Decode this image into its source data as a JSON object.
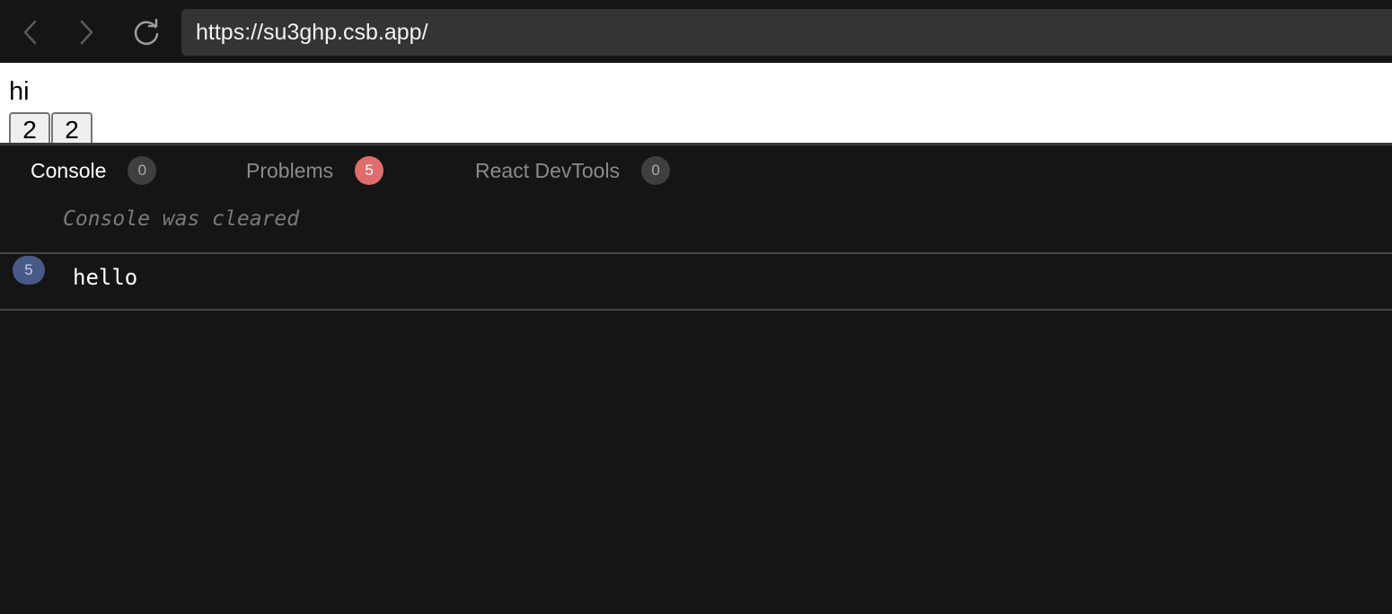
{
  "browser": {
    "url": "https://su3ghp.csb.app/",
    "icons": {
      "back": "chevron-left-icon",
      "forward": "chevron-right-icon",
      "reload": "reload-icon"
    }
  },
  "preview": {
    "text": "hi",
    "buttons": [
      "2",
      "2"
    ]
  },
  "devtools": {
    "tabs": [
      {
        "label": "Console",
        "count": "0",
        "active": true
      },
      {
        "label": "Problems",
        "count": "5",
        "active": false
      },
      {
        "label": "React DevTools",
        "count": "0",
        "active": false
      }
    ],
    "console": {
      "cleared_message": "Console was cleared",
      "entries": [
        {
          "count": "5",
          "message": "hello"
        }
      ]
    }
  },
  "colors": {
    "background": "#151515",
    "url_bar": "#343434",
    "problems_badge": "#e06d6d",
    "log_count_badge": "#475a87"
  }
}
